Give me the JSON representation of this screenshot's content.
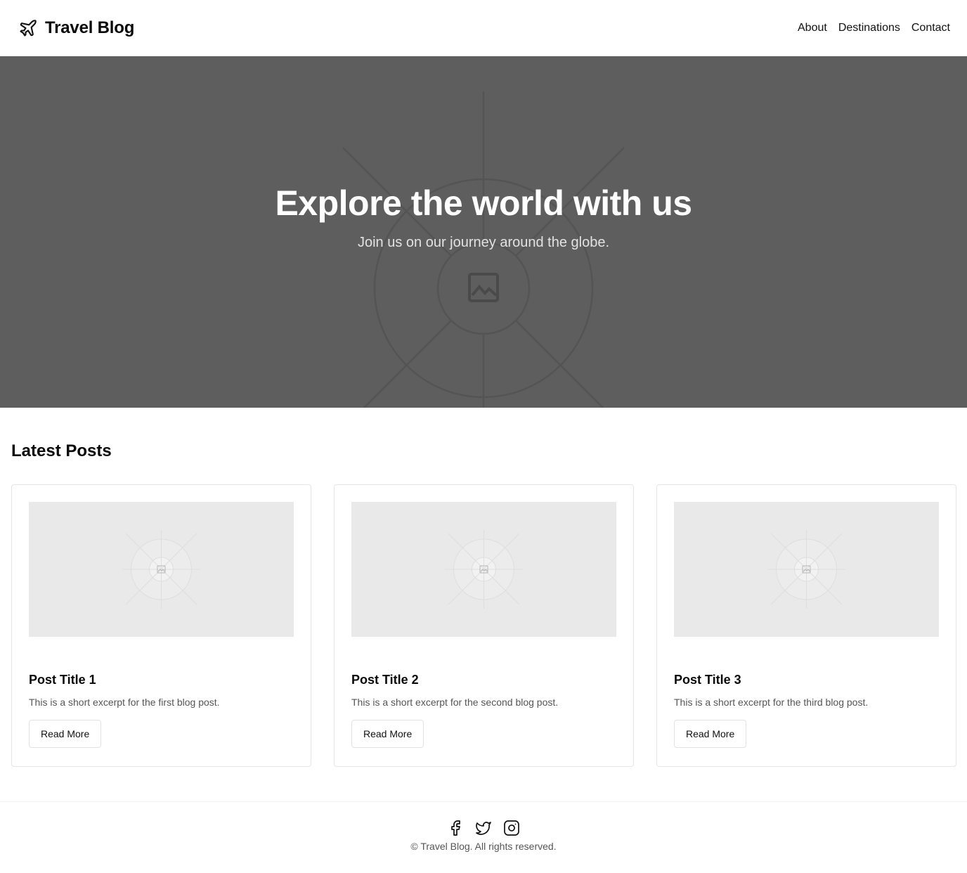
{
  "header": {
    "brand_icon": "airplane-icon",
    "title": "Travel Blog",
    "nav": [
      {
        "label": "About"
      },
      {
        "label": "Destinations"
      },
      {
        "label": "Contact"
      }
    ]
  },
  "hero": {
    "title": "Explore the world with us",
    "subtitle": "Join us on our journey around the globe.",
    "background_icon": "image-placeholder-icon"
  },
  "posts": {
    "title": "Latest Posts",
    "items": [
      {
        "title": "Post Title 1",
        "excerpt": "This is a short excerpt for the first blog post.",
        "button": "Read More",
        "image_icon": "image-placeholder-icon"
      },
      {
        "title": "Post Title 2",
        "excerpt": "This is a short excerpt for the second blog post.",
        "button": "Read More",
        "image_icon": "image-placeholder-icon"
      },
      {
        "title": "Post Title 3",
        "excerpt": "This is a short excerpt for the third blog post.",
        "button": "Read More",
        "image_icon": "image-placeholder-icon"
      }
    ]
  },
  "footer": {
    "social": [
      "facebook-icon",
      "twitter-icon",
      "instagram-icon"
    ],
    "copyright": "© Travel Blog. All rights reserved."
  },
  "colors": {
    "hero_bg": "#5e5e5e",
    "placeholder_bg": "#e9e9e9",
    "text": "#111111",
    "muted": "#555555",
    "border": "#e5e5e5"
  }
}
